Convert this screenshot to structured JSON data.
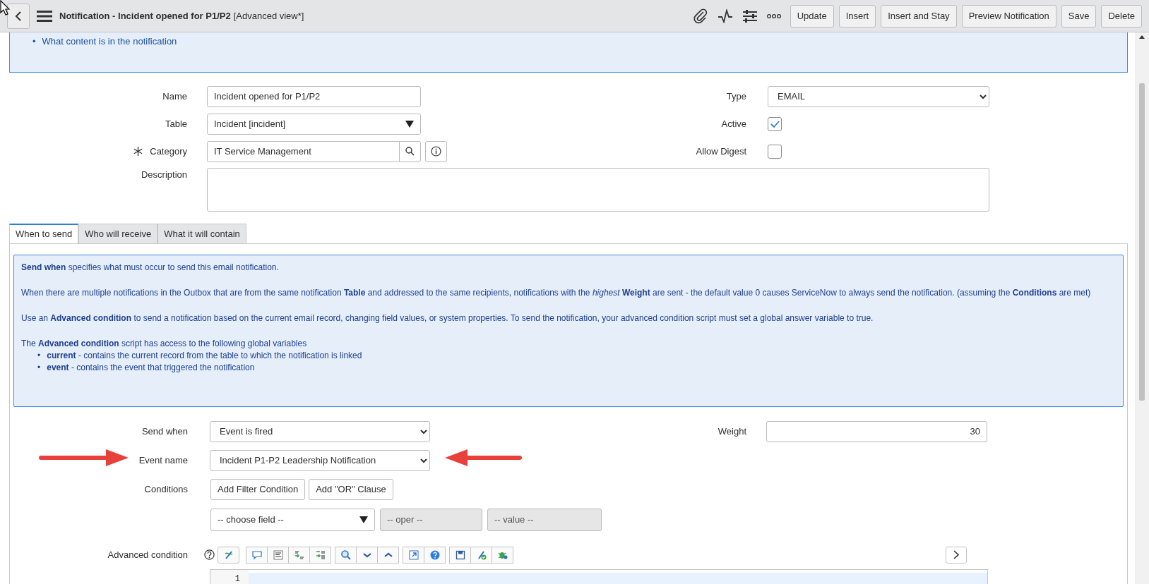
{
  "header": {
    "title": "Notification - Incident opened for P1/P2",
    "view": "[Advanced view*]",
    "buttons": [
      "Update",
      "Insert",
      "Insert and Stay",
      "Preview Notification",
      "Save",
      "Delete"
    ]
  },
  "intro_box": {
    "items": [
      {
        "bullet": "•",
        "text": "What content is in the notification"
      }
    ]
  },
  "form": {
    "left": [
      {
        "kind": "text",
        "label": "Name",
        "value": "Incident opened for P1/P2"
      },
      {
        "kind": "reference",
        "label": "Table",
        "value": "Incident [incident]"
      },
      {
        "kind": "lookup",
        "label": "Category",
        "value": "IT Service Management",
        "mandatory": true
      }
    ],
    "right": [
      {
        "kind": "select",
        "label": "Type",
        "value": "EMAIL"
      },
      {
        "kind": "checkbox",
        "label": "Active",
        "checked": true
      },
      {
        "kind": "checkbox",
        "label": "Allow Digest",
        "checked": false
      }
    ],
    "description": {
      "label": "Description"
    }
  },
  "tabs": [
    {
      "label": "When to send",
      "selected": true
    },
    {
      "label": "Who will receive",
      "selected": false
    },
    {
      "label": "What it will contain",
      "selected": false
    }
  ],
  "help_box": {
    "paragraphs": [
      "**Send when** specifies what must occur to send this email notification.",
      "When there are multiple notifications in the Outbox that are from the same notification **Table** and addressed to the same recipients, notifications with the *highest* **Weight** are sent - the default value 0 causes ServiceNow to always send the notification. (assuming the **Conditions** are met)",
      "Use an **Advanced condition** to send a notification based on the current email record, changing field values, or system properties. To send the notification, your advanced condition script must set a global answer variable to true.",
      "The **Advanced condition** script has access to the following global variables"
    ],
    "items": [
      {
        "bullet": "•",
        "text": "**current** - contains the current record from the table to which the notification is linked"
      },
      {
        "bullet": "•",
        "text": "**event** - contains the event that triggered the notification"
      }
    ]
  },
  "send": {
    "send_when": {
      "label": "Send when",
      "value": "Event is fired"
    },
    "weight": {
      "label": "Weight",
      "value": "30"
    },
    "event_name": {
      "label": "Event name",
      "value": "Incident P1-P2 Leadership Notification"
    },
    "conditions": {
      "label": "Conditions",
      "buttons": [
        "Add Filter Condition",
        "Add \"OR\" Clause"
      ],
      "field": "-- choose field --",
      "oper": "-- oper --",
      "value": "-- value --"
    },
    "advanced": {
      "label": "Advanced condition",
      "line_numbers": [
        "1"
      ]
    }
  }
}
